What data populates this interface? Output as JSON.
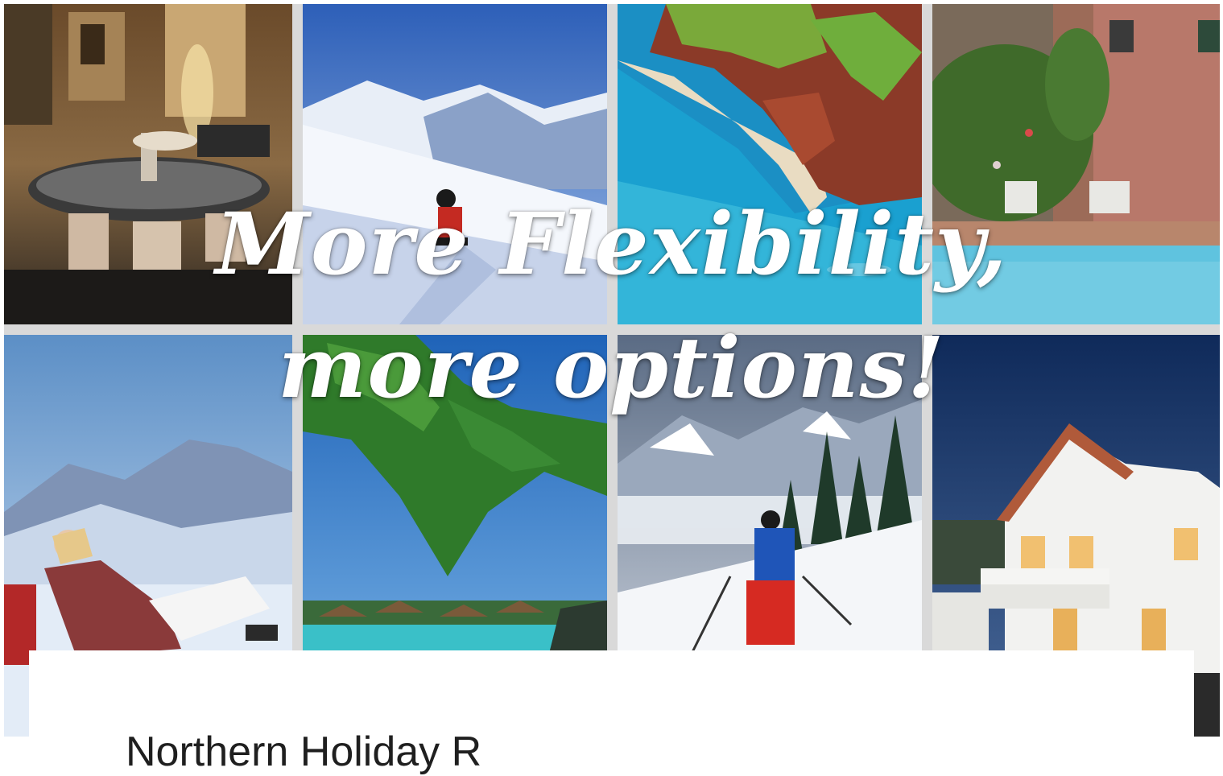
{
  "hero": {
    "headline_line1": "More Flexibility,",
    "headline_line2": "more options!",
    "tiles": [
      {
        "name": "courtyard-fountain-photo"
      },
      {
        "name": "snowboarder-photo"
      },
      {
        "name": "coastline-cliffs-photo"
      },
      {
        "name": "villa-pool-photo"
      },
      {
        "name": "alpine-sunbather-photo"
      },
      {
        "name": "tropical-overwater-bungalows-photo"
      },
      {
        "name": "skier-mountain-photo"
      },
      {
        "name": "luxury-villa-photo"
      }
    ]
  },
  "card": {
    "title": "Northern Holiday R"
  }
}
